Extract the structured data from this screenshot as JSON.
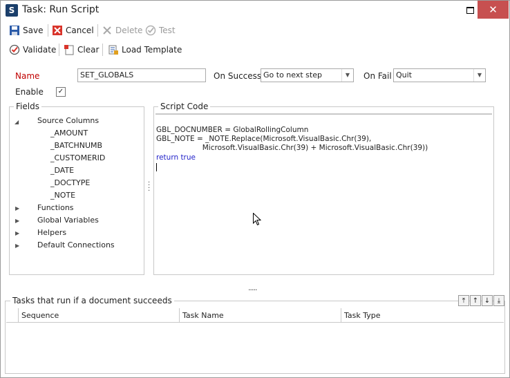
{
  "window": {
    "title": "Task: Run Script",
    "app_icon": "S"
  },
  "toolbar": {
    "save": "Save",
    "cancel": "Cancel",
    "delete": "Delete",
    "test": "Test",
    "validate": "Validate",
    "clear": "Clear",
    "load_template": "Load Template"
  },
  "form": {
    "name_label": "Name",
    "name_value": "SET_GLOBALS",
    "on_success_label": "On Success",
    "on_success_value": "Go to next step",
    "on_fail_label": "On Fail",
    "on_fail_value": "Quit",
    "enable_label": "Enable",
    "enable_checked": true
  },
  "fields": {
    "title": "Fields",
    "tree": [
      {
        "label": "Source Columns",
        "expanded": true,
        "children": [
          "_AMOUNT",
          "_BATCHNUMB",
          "_CUSTOMERID",
          "_DATE",
          "_DOCTYPE",
          "_NOTE"
        ]
      },
      {
        "label": "Functions"
      },
      {
        "label": "Global Variables"
      },
      {
        "label": "Helpers"
      },
      {
        "label": "Default Connections"
      }
    ]
  },
  "script": {
    "title": "Script Code",
    "line1": "GBL_DOCNUMBER = GlobalRollingColumn",
    "line2": "GBL_NOTE = _NOTE.Replace(Microsoft.VisualBasic.Chr(39),",
    "line3": "                    Microsoft.VisualBasic.Chr(39) + Microsoft.VisualBasic.Chr(39))",
    "line4": "return true"
  },
  "tasks": {
    "title": "Tasks that run if a document succeeds",
    "columns": [
      "Sequence",
      "Task Name",
      "Task Type"
    ],
    "splitter": "....."
  },
  "colors": {
    "name_label": "#c00000",
    "keyword": "#1e1ec8",
    "close": "#c75050"
  }
}
